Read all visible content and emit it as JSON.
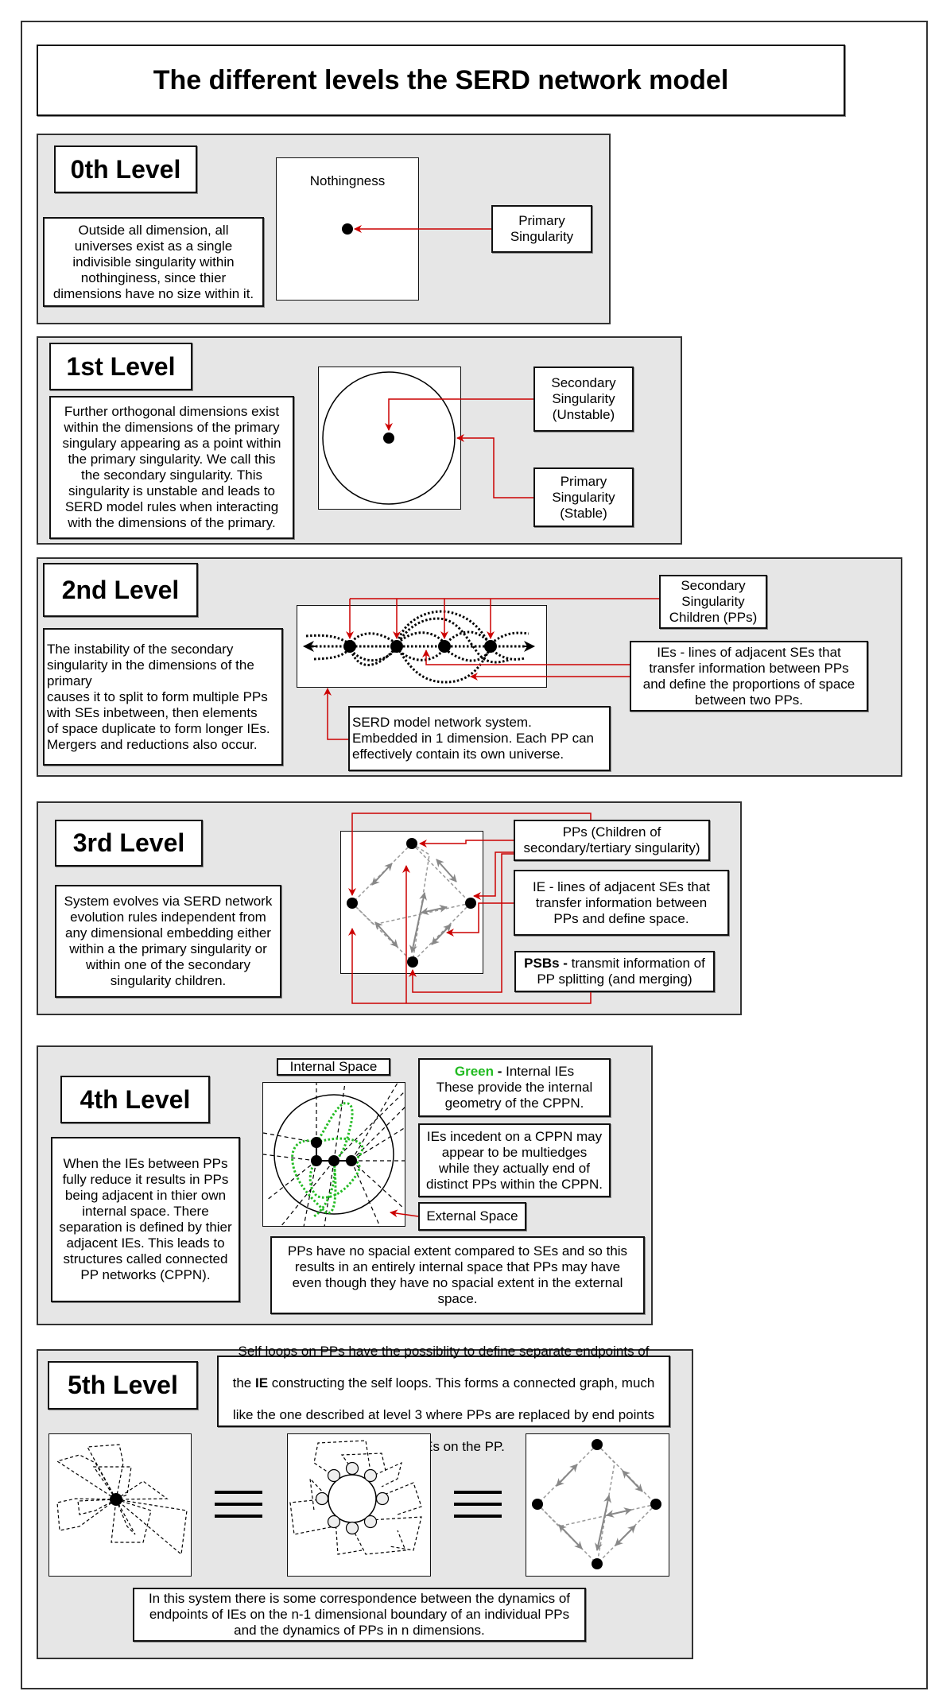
{
  "title": "The different levels the SERD network model",
  "colors": {
    "panel_bg": "#e6e6e6",
    "arrow_red": "#cc0000",
    "internal_ie_green": "#22bb22",
    "ie_arrow_gray": "#888888"
  },
  "levels": [
    {
      "heading": "0th Level",
      "description": "Outside all dimension, all\nuniverses exist as a single\nindivisible singularity within\nnothinginess, since thier\ndimensions have no size within it.",
      "diagram_label": "Nothingness",
      "callouts": [
        "Primary\nSingularity"
      ]
    },
    {
      "heading": "1st Level",
      "description": "Further orthogonal dimensions exist\nwithin the dimensions of the primary\nsingulary appearing as a point within\nthe primary singularity. We call this\nthe secondary singularity. This\nsingularity is unstable and leads to\nSERD model rules when interacting\nwith the dimensions of the primary.",
      "callouts": [
        "Secondary\nSingularity\n(Unstable)",
        "Primary\nSingularity\n(Stable)"
      ]
    },
    {
      "heading": "2nd Level",
      "description": "The instability of the secondary\nsingularity in the dimensions of the\nprimary\ncauses it to split to form multiple PPs\nwith SEs inbetween, then elements\nof space duplicate to form longer IEs.\nMergers and reductions also occur.",
      "callouts": [
        "Secondary\nSingularity\nChildren (PPs)",
        "IEs - lines of adjacent SEs that\ntransfer information between PPs\nand define the proportions of space\nbetween two PPs.",
        "SERD model network system.\nEmbedded in 1 dimension. Each PP can\neffectively contain its own universe."
      ]
    },
    {
      "heading": "3rd Level",
      "description": "System evolves via SERD network\nevolution rules independent from\nany dimensional embedding either\nwithin a the primary singularity or\nwithin one of the secondary\nsingularity children.",
      "callouts": [
        "PPs (Children of\nsecondary/tertiary singularity)",
        "IE - lines of adjacent SEs that\ntransfer information between\nPPs and define space.",
        {
          "bold": "PSBs -",
          "rest": " transmit information of\nPP splitting (and merging)"
        }
      ]
    },
    {
      "heading": "4th Level",
      "description": "When the IEs between PPs\nfully reduce it results in PPs\nbeing adjacent in thier own\ninternal space. There\nseparation is defined by thier\nadjacent IEs. This leads to\nstructures called connected\nPP networks (CPPN).",
      "diagram_label": "Internal Space",
      "callouts": [
        {
          "green": "Green",
          "bold": " -",
          "rest": " Internal IEs\nThese provide the internal\ngeometry of the CPPN."
        },
        "IEs incedent on a CPPN may\nappear to be multiedges\nwhile they actually end of\ndistinct PPs within the CPPN.",
        "External Space",
        "PPs have no spacial extent compared to SEs and so this\nresults in an entirely internal space that PPs may have\neven though they have no spacial extent in the external\nspace."
      ]
    },
    {
      "heading": "5th Level",
      "intro": {
        "line1": "Self loops on PPs have the possiblity to define separate endpoints of",
        "line2_pre": "the ",
        "line2_bold": "IE",
        "line2_post": " constructing the self loops. This forms a connected graph, much",
        "line3": "like the one described at level 3 where PPs are replaced by end points",
        "line4": "of the IEs on the PP."
      },
      "equivalence_symbol": "≡",
      "conclusion": "In this system there is some correspondence between the dynamics of\nendpoints of IEs on the n-1 dimensional boundary of an individual PPs\nand the dynamics of PPs in n dimensions."
    }
  ]
}
